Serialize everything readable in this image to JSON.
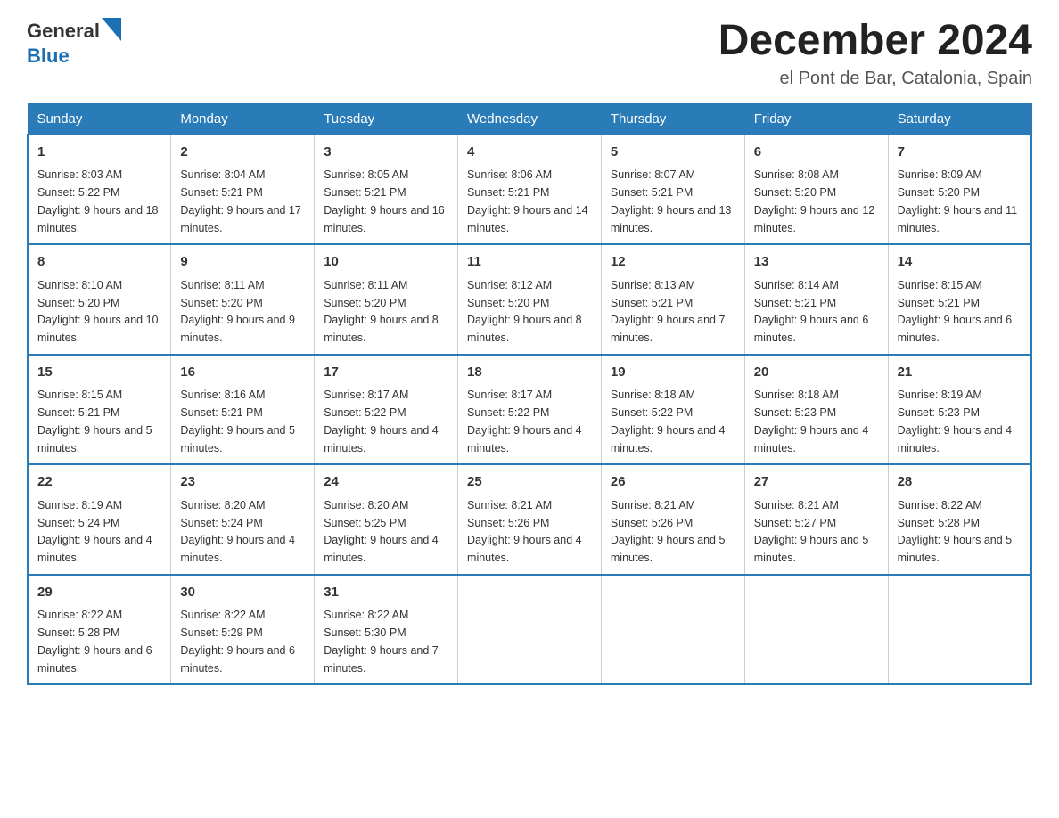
{
  "header": {
    "logo_general": "General",
    "logo_blue": "Blue",
    "month_title": "December 2024",
    "location": "el Pont de Bar, Catalonia, Spain"
  },
  "days_of_week": [
    "Sunday",
    "Monday",
    "Tuesday",
    "Wednesday",
    "Thursday",
    "Friday",
    "Saturday"
  ],
  "weeks": [
    [
      {
        "day": "1",
        "sunrise": "8:03 AM",
        "sunset": "5:22 PM",
        "daylight": "9 hours and 18 minutes."
      },
      {
        "day": "2",
        "sunrise": "8:04 AM",
        "sunset": "5:21 PM",
        "daylight": "9 hours and 17 minutes."
      },
      {
        "day": "3",
        "sunrise": "8:05 AM",
        "sunset": "5:21 PM",
        "daylight": "9 hours and 16 minutes."
      },
      {
        "day": "4",
        "sunrise": "8:06 AM",
        "sunset": "5:21 PM",
        "daylight": "9 hours and 14 minutes."
      },
      {
        "day": "5",
        "sunrise": "8:07 AM",
        "sunset": "5:21 PM",
        "daylight": "9 hours and 13 minutes."
      },
      {
        "day": "6",
        "sunrise": "8:08 AM",
        "sunset": "5:20 PM",
        "daylight": "9 hours and 12 minutes."
      },
      {
        "day": "7",
        "sunrise": "8:09 AM",
        "sunset": "5:20 PM",
        "daylight": "9 hours and 11 minutes."
      }
    ],
    [
      {
        "day": "8",
        "sunrise": "8:10 AM",
        "sunset": "5:20 PM",
        "daylight": "9 hours and 10 minutes."
      },
      {
        "day": "9",
        "sunrise": "8:11 AM",
        "sunset": "5:20 PM",
        "daylight": "9 hours and 9 minutes."
      },
      {
        "day": "10",
        "sunrise": "8:11 AM",
        "sunset": "5:20 PM",
        "daylight": "9 hours and 8 minutes."
      },
      {
        "day": "11",
        "sunrise": "8:12 AM",
        "sunset": "5:20 PM",
        "daylight": "9 hours and 8 minutes."
      },
      {
        "day": "12",
        "sunrise": "8:13 AM",
        "sunset": "5:21 PM",
        "daylight": "9 hours and 7 minutes."
      },
      {
        "day": "13",
        "sunrise": "8:14 AM",
        "sunset": "5:21 PM",
        "daylight": "9 hours and 6 minutes."
      },
      {
        "day": "14",
        "sunrise": "8:15 AM",
        "sunset": "5:21 PM",
        "daylight": "9 hours and 6 minutes."
      }
    ],
    [
      {
        "day": "15",
        "sunrise": "8:15 AM",
        "sunset": "5:21 PM",
        "daylight": "9 hours and 5 minutes."
      },
      {
        "day": "16",
        "sunrise": "8:16 AM",
        "sunset": "5:21 PM",
        "daylight": "9 hours and 5 minutes."
      },
      {
        "day": "17",
        "sunrise": "8:17 AM",
        "sunset": "5:22 PM",
        "daylight": "9 hours and 4 minutes."
      },
      {
        "day": "18",
        "sunrise": "8:17 AM",
        "sunset": "5:22 PM",
        "daylight": "9 hours and 4 minutes."
      },
      {
        "day": "19",
        "sunrise": "8:18 AM",
        "sunset": "5:22 PM",
        "daylight": "9 hours and 4 minutes."
      },
      {
        "day": "20",
        "sunrise": "8:18 AM",
        "sunset": "5:23 PM",
        "daylight": "9 hours and 4 minutes."
      },
      {
        "day": "21",
        "sunrise": "8:19 AM",
        "sunset": "5:23 PM",
        "daylight": "9 hours and 4 minutes."
      }
    ],
    [
      {
        "day": "22",
        "sunrise": "8:19 AM",
        "sunset": "5:24 PM",
        "daylight": "9 hours and 4 minutes."
      },
      {
        "day": "23",
        "sunrise": "8:20 AM",
        "sunset": "5:24 PM",
        "daylight": "9 hours and 4 minutes."
      },
      {
        "day": "24",
        "sunrise": "8:20 AM",
        "sunset": "5:25 PM",
        "daylight": "9 hours and 4 minutes."
      },
      {
        "day": "25",
        "sunrise": "8:21 AM",
        "sunset": "5:26 PM",
        "daylight": "9 hours and 4 minutes."
      },
      {
        "day": "26",
        "sunrise": "8:21 AM",
        "sunset": "5:26 PM",
        "daylight": "9 hours and 5 minutes."
      },
      {
        "day": "27",
        "sunrise": "8:21 AM",
        "sunset": "5:27 PM",
        "daylight": "9 hours and 5 minutes."
      },
      {
        "day": "28",
        "sunrise": "8:22 AM",
        "sunset": "5:28 PM",
        "daylight": "9 hours and 5 minutes."
      }
    ],
    [
      {
        "day": "29",
        "sunrise": "8:22 AM",
        "sunset": "5:28 PM",
        "daylight": "9 hours and 6 minutes."
      },
      {
        "day": "30",
        "sunrise": "8:22 AM",
        "sunset": "5:29 PM",
        "daylight": "9 hours and 6 minutes."
      },
      {
        "day": "31",
        "sunrise": "8:22 AM",
        "sunset": "5:30 PM",
        "daylight": "9 hours and 7 minutes."
      },
      null,
      null,
      null,
      null
    ]
  ]
}
